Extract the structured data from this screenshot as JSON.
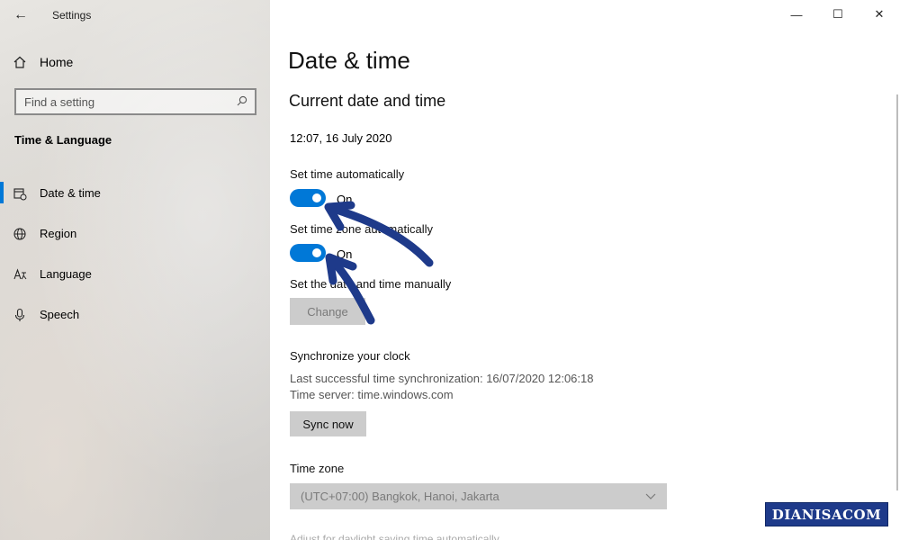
{
  "window": {
    "app_title": "Settings",
    "back_icon": "back-arrow-icon",
    "controls": [
      "minimize-icon",
      "maximize-icon",
      "close-icon"
    ]
  },
  "sidebar": {
    "home_label": "Home",
    "search_placeholder": "Find a setting",
    "section_title": "Time & Language",
    "items": [
      {
        "label": "Date & time",
        "icon": "calendar-clock-icon",
        "active": true
      },
      {
        "label": "Region",
        "icon": "globe-icon",
        "active": false
      },
      {
        "label": "Language",
        "icon": "language-icon",
        "active": false
      },
      {
        "label": "Speech",
        "icon": "microphone-icon",
        "active": false
      }
    ]
  },
  "main": {
    "page_title": "Date & time",
    "section_title": "Current date and time",
    "current_datetime": "12:07, 16 July 2020",
    "set_time_auto": {
      "label": "Set time automatically",
      "state": "On"
    },
    "set_timezone_auto": {
      "label": "Set time zone automatically",
      "state": "On"
    },
    "manual": {
      "label": "Set the date and time manually",
      "button": "Change"
    },
    "sync": {
      "title": "Synchronize your clock",
      "last_sync": "Last successful time synchronization: 16/07/2020 12:06:18",
      "server": "Time server: time.windows.com",
      "button": "Sync now"
    },
    "timezone": {
      "label": "Time zone",
      "value": "(UTC+07:00) Bangkok, Hanoi, Jakarta"
    },
    "cutoff_text": "Adjust for daylight saving time automatically"
  },
  "accent_color": "#0078d7",
  "annotation_color": "#1e3a8a",
  "watermark": "DIANISACOM"
}
